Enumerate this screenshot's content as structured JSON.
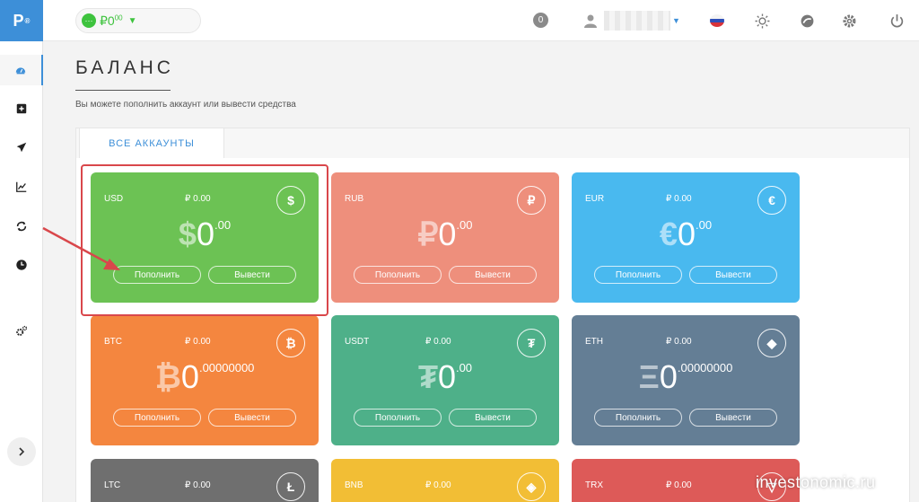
{
  "app": {
    "logo_text": "P",
    "logo_mark": "®"
  },
  "wallet": {
    "dot_text": "···",
    "currency_symbol": "₽",
    "amount_int": "0",
    "amount_dec": "00"
  },
  "topbar": {
    "notifications": "0"
  },
  "sidebar": {
    "items": [
      "dashboard-icon",
      "plus-box-icon",
      "send-icon",
      "chart-icon",
      "exchange-icon",
      "clock-icon",
      "settings-icon"
    ]
  },
  "page": {
    "title": "БАЛАНС",
    "subtitle": "Вы можете пополнить аккаунт или вывести средства",
    "tab": "ВСЕ АККАУНТЫ"
  },
  "buttons": {
    "deposit": "Пополнить",
    "withdraw": "Вывести"
  },
  "cards": [
    {
      "code": "USD",
      "rub": "₽ 0.00",
      "icon": "$",
      "symbol": "$",
      "int": "0",
      "dec": ".00",
      "color": "#6cc254"
    },
    {
      "code": "RUB",
      "rub": "",
      "icon": "₽",
      "symbol": "₽",
      "int": "0",
      "dec": ".00",
      "color": "#ee8f7c"
    },
    {
      "code": "EUR",
      "rub": "₽ 0.00",
      "icon": "€",
      "symbol": "€",
      "int": "0",
      "dec": ".00",
      "color": "#49b9ef"
    },
    {
      "code": "BTC",
      "rub": "₽ 0.00",
      "icon": "₿",
      "symbol": "₿",
      "int": "0",
      "dec": ".00000000",
      "color": "#f4863f"
    },
    {
      "code": "USDT",
      "rub": "₽ 0.00",
      "icon": "₮",
      "symbol": "₮",
      "int": "0",
      "dec": ".00",
      "color": "#4eb089"
    },
    {
      "code": "ETH",
      "rub": "₽ 0.00",
      "icon": "◆",
      "symbol": "Ξ",
      "int": "0",
      "dec": ".00000000",
      "color": "#647e95"
    },
    {
      "code": "LTC",
      "rub": "₽ 0.00",
      "icon": "Ł",
      "color": "#6f6f6f"
    },
    {
      "code": "BNB",
      "rub": "₽ 0.00",
      "icon": "◈",
      "color": "#f2be35"
    },
    {
      "code": "TRX",
      "rub": "₽ 0.00",
      "icon": "▽",
      "color": "#dd5a58"
    }
  ],
  "watermark": "investonomic.ru"
}
